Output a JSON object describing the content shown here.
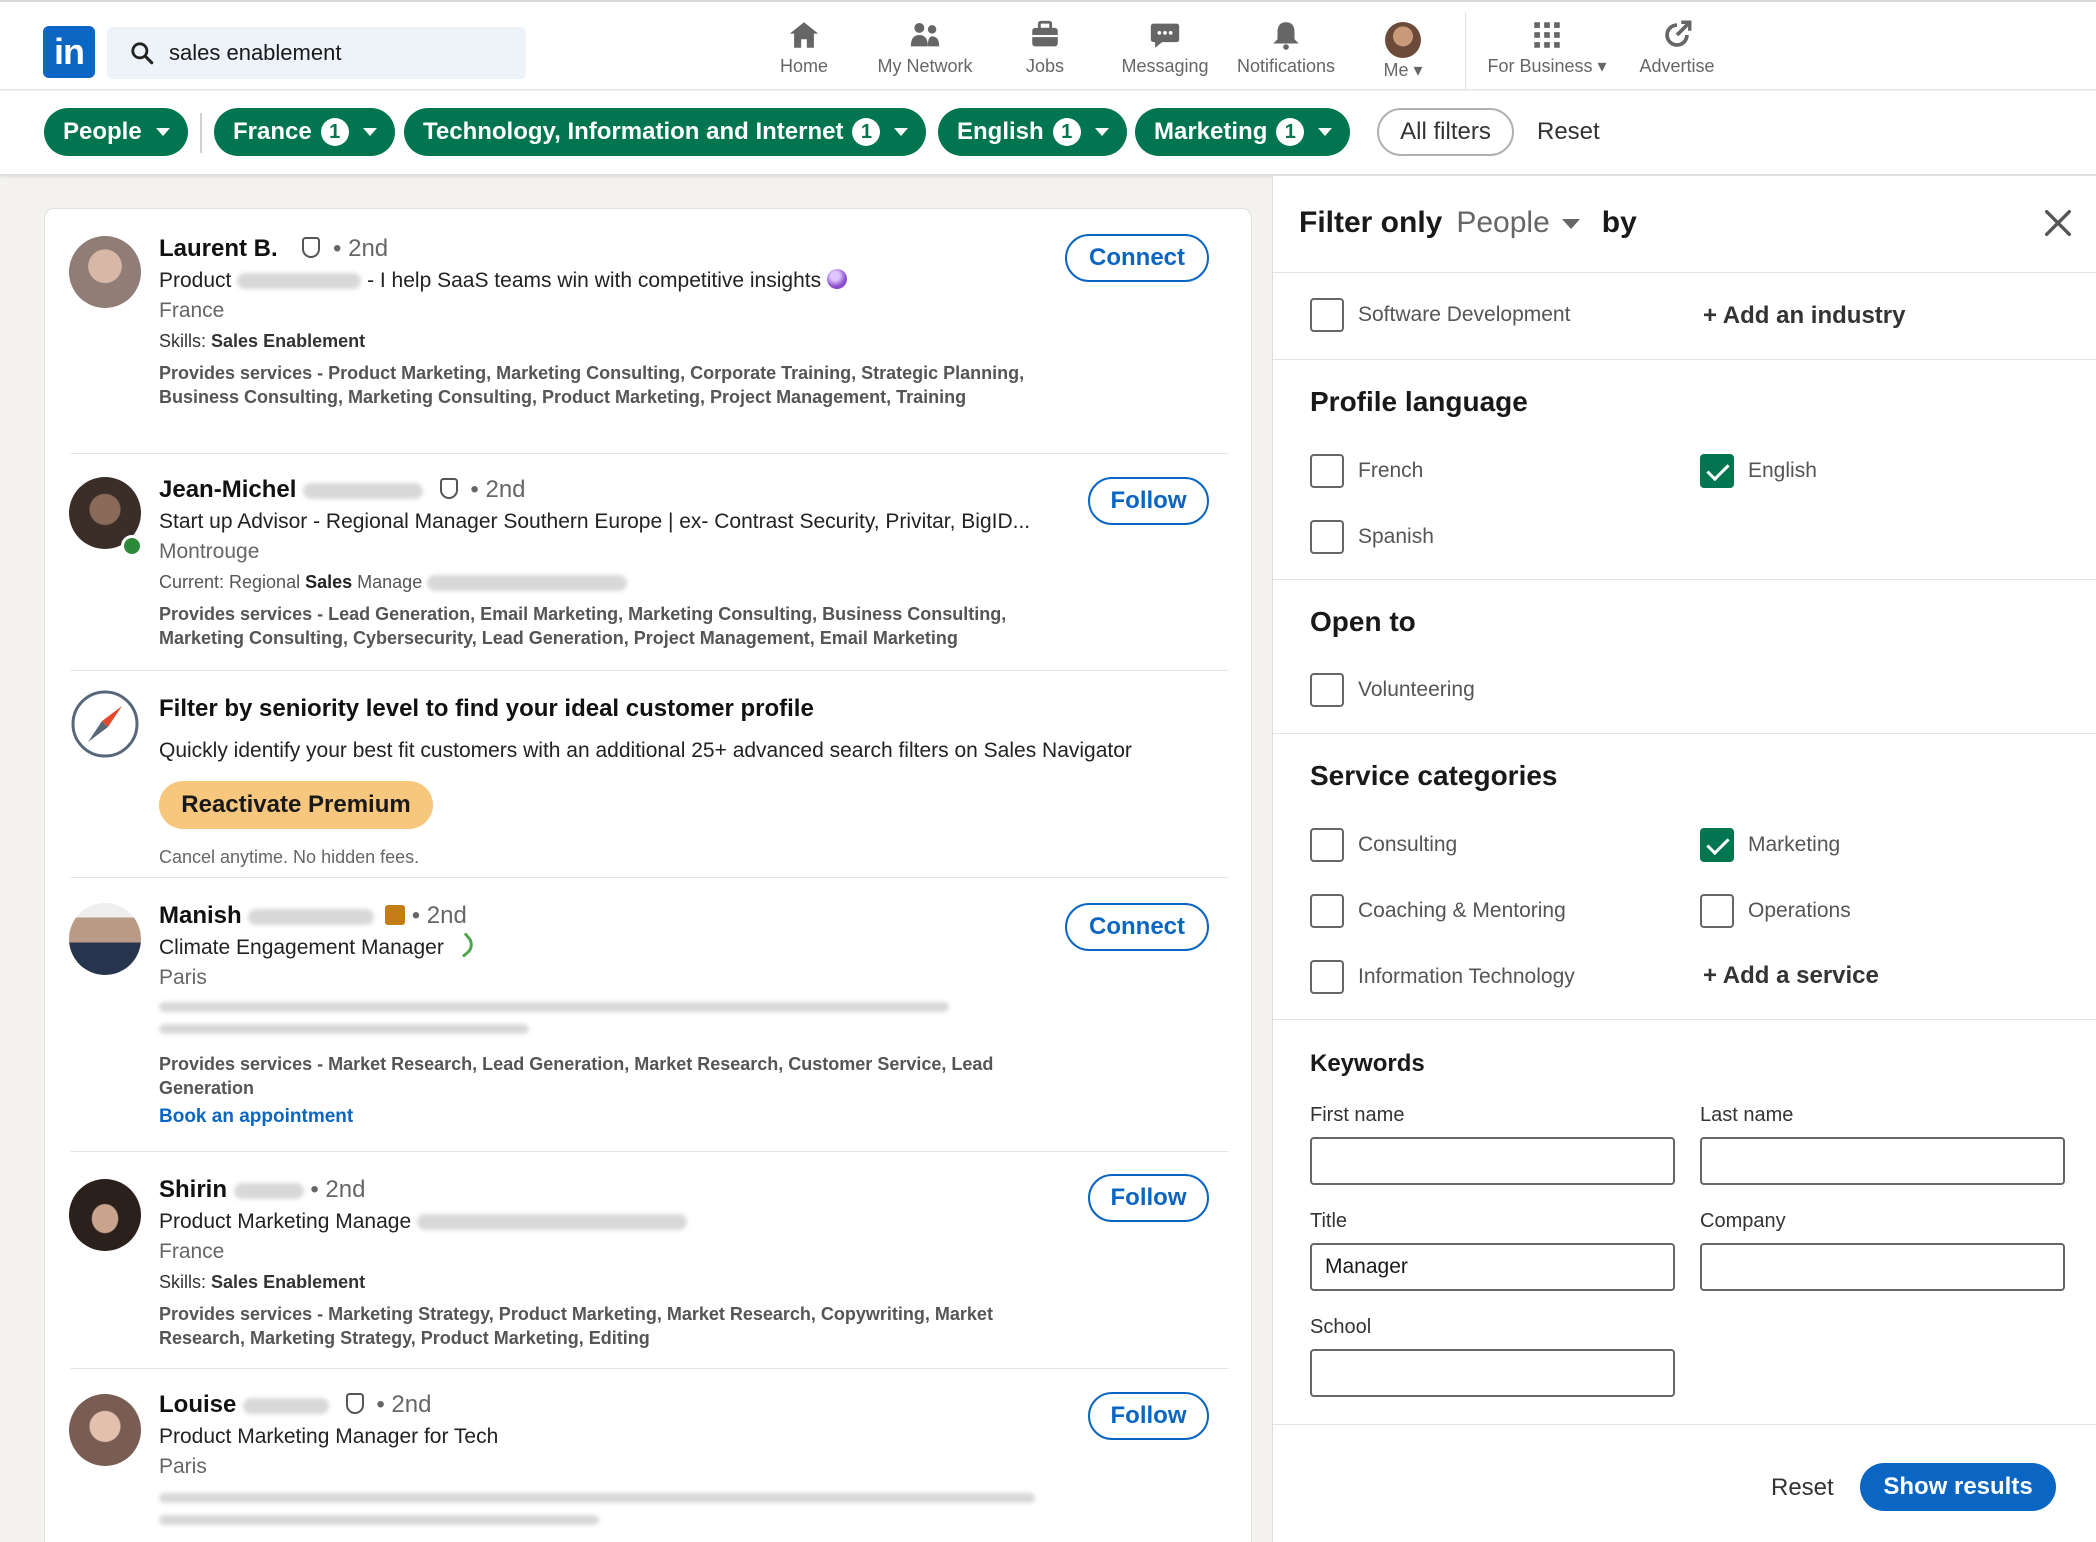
{
  "nav": {
    "search_value": "sales enablement",
    "items": [
      {
        "label": "Home"
      },
      {
        "label": "My Network"
      },
      {
        "label": "Jobs"
      },
      {
        "label": "Messaging"
      },
      {
        "label": "Notifications"
      },
      {
        "label": "Me"
      },
      {
        "label": "For Business"
      },
      {
        "label": "Advertise"
      }
    ]
  },
  "filters": {
    "people": "People",
    "pills": [
      {
        "label": "France",
        "count": "1"
      },
      {
        "label": "Technology, Information and Internet",
        "count": "1"
      },
      {
        "label": "English",
        "count": "1"
      },
      {
        "label": "Marketing",
        "count": "1"
      }
    ],
    "all_filters": "All filters",
    "reset": "Reset"
  },
  "results": [
    {
      "first": "Laurent B.",
      "degree": "• 2nd",
      "headline_a": "Product",
      "headline_b": "- I help SaaS teams win with competitive insights",
      "location": "France",
      "skills_label": "Skills:",
      "skills": "Sales Enablement",
      "services": "Provides services - Product Marketing, Marketing Consulting, Corporate Training, Strategic Planning, Business Consulting, Marketing Consulting, Product Marketing, Project Management, Training",
      "action": "Connect"
    },
    {
      "first": "Jean-Michel",
      "degree": "• 2nd",
      "headline": "Start up Advisor - Regional Manager Southern Europe | ex- Contrast Security, Privitar, BigID...",
      "location": "Montrouge",
      "current_a": "Current: Regional",
      "current_b": "Sales",
      "current_c": "Manage",
      "services": "Provides services - Lead Generation, Email Marketing, Marketing Consulting, Business Consulting, Marketing Consulting, Cybersecurity, Lead Generation, Project Management, Email Marketing",
      "action": "Follow"
    },
    {
      "first": "Manish",
      "degree": "• 2nd",
      "headline": "Climate Engagement Manager",
      "location": "Paris",
      "services": "Provides services - Market Research, Lead Generation, Market Research, Customer Service, Lead Generation",
      "link": "Book an appointment",
      "action": "Connect"
    },
    {
      "first": "Shirin",
      "degree": "• 2nd",
      "headline": "Product Marketing Manage",
      "location": "France",
      "skills_label": "Skills:",
      "skills": "Sales Enablement",
      "services": "Provides services - Marketing Strategy, Product Marketing, Market Research, Copywriting, Market Research, Marketing Strategy, Product Marketing, Editing",
      "action": "Follow"
    },
    {
      "first": "Louise",
      "degree": "• 2nd",
      "headline": "Product Marketing Manager for Tech",
      "location": "Paris",
      "action": "Follow"
    }
  ],
  "promo": {
    "title": "Filter by seniority level to find your ideal customer profile",
    "body": "Quickly identify your best fit customers with an additional 25+ advanced search filters on Sales Navigator",
    "button": "Reactivate Premium",
    "note": "Cancel anytime. No hidden fees."
  },
  "panel": {
    "title_a": "Filter only",
    "title_sel": "People",
    "title_b": "by",
    "industry_option": "Software Development",
    "add_industry": "+ Add an industry",
    "profile_language": {
      "heading": "Profile language",
      "options": [
        "French",
        "English",
        "Spanish"
      ]
    },
    "open_to": {
      "heading": "Open to",
      "options": [
        "Volunteering"
      ]
    },
    "service_categories": {
      "heading": "Service categories",
      "options": [
        "Consulting",
        "Marketing",
        "Coaching & Mentoring",
        "Operations",
        "Information Technology"
      ],
      "add": "+ Add a service"
    },
    "keywords": {
      "heading": "Keywords",
      "first_name": "First name",
      "last_name": "Last name",
      "title": "Title",
      "title_value": "Manager",
      "company": "Company",
      "school": "School"
    },
    "reset": "Reset",
    "show_results": "Show results"
  },
  "colors": {
    "brand": "#0a66c2",
    "filter_green": "#01754f",
    "premium": "#f8c77e"
  }
}
